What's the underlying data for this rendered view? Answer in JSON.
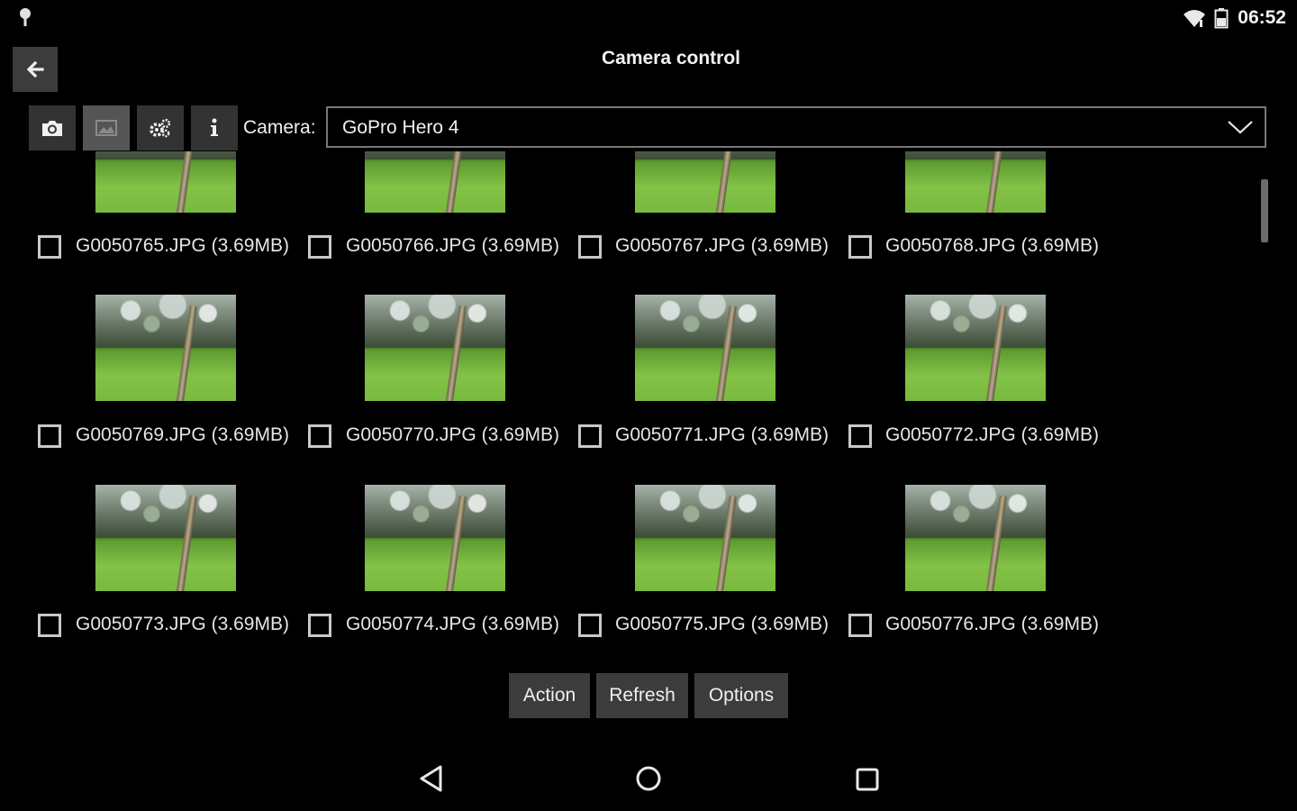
{
  "status_bar": {
    "time": "06:52",
    "left_icon": "notification-icon",
    "wifi_icon": "wifi-icon",
    "battery_icon": "battery-icon"
  },
  "header": {
    "title": "Camera control",
    "back_icon": "arrow-left-icon"
  },
  "toolbar": {
    "buttons": [
      {
        "icon": "camera-icon",
        "active": false
      },
      {
        "icon": "image-icon",
        "active": true
      },
      {
        "icon": "gears-icon",
        "active": false
      },
      {
        "icon": "info-icon",
        "active": false
      }
    ],
    "camera_label": "Camera:",
    "camera_selected": "GoPro Hero 4"
  },
  "files": [
    {
      "name": "G0050765.JPG (3.69MB)",
      "checked": false
    },
    {
      "name": "G0050766.JPG (3.69MB)",
      "checked": false
    },
    {
      "name": "G0050767.JPG (3.69MB)",
      "checked": false
    },
    {
      "name": "G0050768.JPG (3.69MB)",
      "checked": false
    },
    {
      "name": "G0050769.JPG (3.69MB)",
      "checked": false
    },
    {
      "name": "G0050770.JPG (3.69MB)",
      "checked": false
    },
    {
      "name": "G0050771.JPG (3.69MB)",
      "checked": false
    },
    {
      "name": "G0050772.JPG (3.69MB)",
      "checked": false
    },
    {
      "name": "G0050773.JPG (3.69MB)",
      "checked": false
    },
    {
      "name": "G0050774.JPG (3.69MB)",
      "checked": false
    },
    {
      "name": "G0050775.JPG (3.69MB)",
      "checked": false
    },
    {
      "name": "G0050776.JPG (3.69MB)",
      "checked": false
    }
  ],
  "actions": {
    "action": "Action",
    "refresh": "Refresh",
    "options": "Options"
  },
  "nav": {
    "back_icon": "nav-back-icon",
    "home_icon": "nav-home-icon",
    "recents_icon": "nav-recents-icon"
  },
  "colors": {
    "background": "#000000",
    "button_bg": "#3c3c3c",
    "text": "#f0f0f0"
  }
}
